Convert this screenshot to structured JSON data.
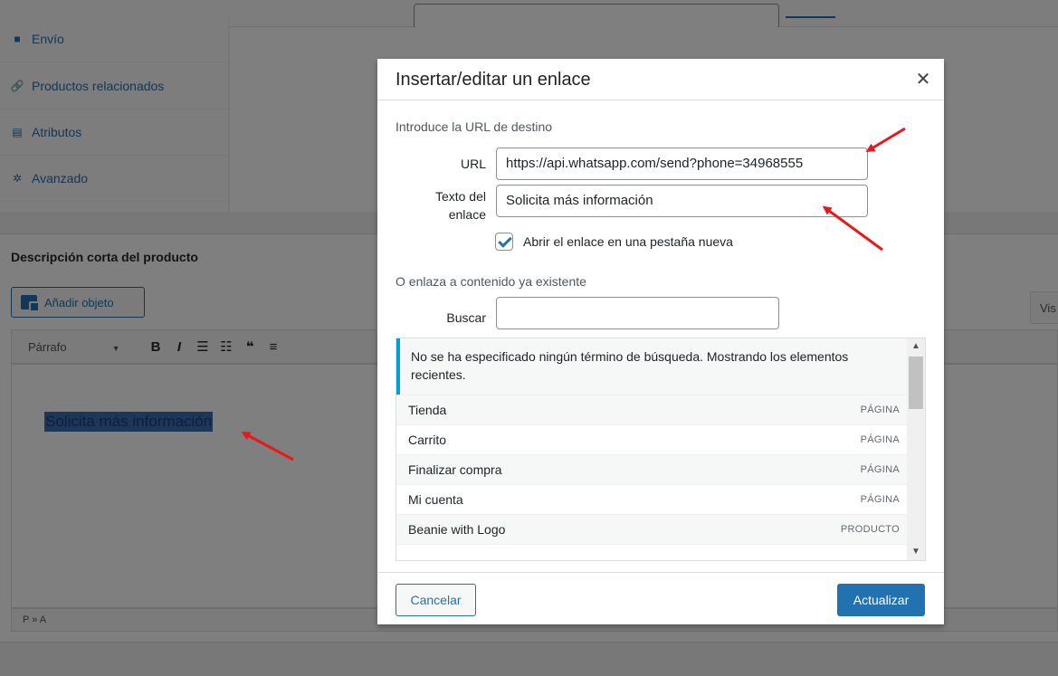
{
  "background": {
    "tabs": [
      {
        "label": "Envío",
        "icon": "truck-icon"
      },
      {
        "label": "Productos relacionados",
        "icon": "link-icon"
      },
      {
        "label": "Atributos",
        "icon": "list-icon"
      },
      {
        "label": "Avanzado",
        "icon": "gear-icon"
      }
    ],
    "section_title": "Descripción corta del producto",
    "add_object_label": "Añadir objeto",
    "visual_tab_label": "Vis",
    "format_select": "Párrafo",
    "toolbar_icons": [
      "B",
      "I",
      "☰",
      "☷",
      "❝",
      "≡"
    ],
    "selected_text": "Solicita más información",
    "path": "P » A"
  },
  "modal": {
    "title": "Insertar/editar un enlace",
    "close_icon": "close-icon",
    "url_section_label": "Introduce la URL de destino",
    "url_label": "URL",
    "url_value": "https://api.whatsapp.com/send?phone=34968555",
    "link_text_label_line1": "Texto del",
    "link_text_label_line2": "enlace",
    "link_text_value": "Solicita más información",
    "new_tab_checked": true,
    "new_tab_label": "Abrir el enlace en una pestaña nueva",
    "existing_section_label": "O enlaza a contenido ya existente",
    "search_label": "Buscar",
    "search_value": "",
    "notice": "No se ha especificado ningún término de búsqueda. Mostrando los elementos recientes.",
    "results": [
      {
        "title": "Tienda",
        "type": "PÁGINA"
      },
      {
        "title": "Carrito",
        "type": "PÁGINA"
      },
      {
        "title": "Finalizar compra",
        "type": "PÁGINA"
      },
      {
        "title": "Mi cuenta",
        "type": "PÁGINA"
      },
      {
        "title": "Beanie with Logo",
        "type": "PRODUCTO"
      }
    ],
    "cancel_label": "Cancelar",
    "update_label": "Actualizar"
  },
  "colors": {
    "accent": "#2271b1",
    "notice_border": "#00a0d2",
    "annotation_arrow": "#e8191b"
  }
}
